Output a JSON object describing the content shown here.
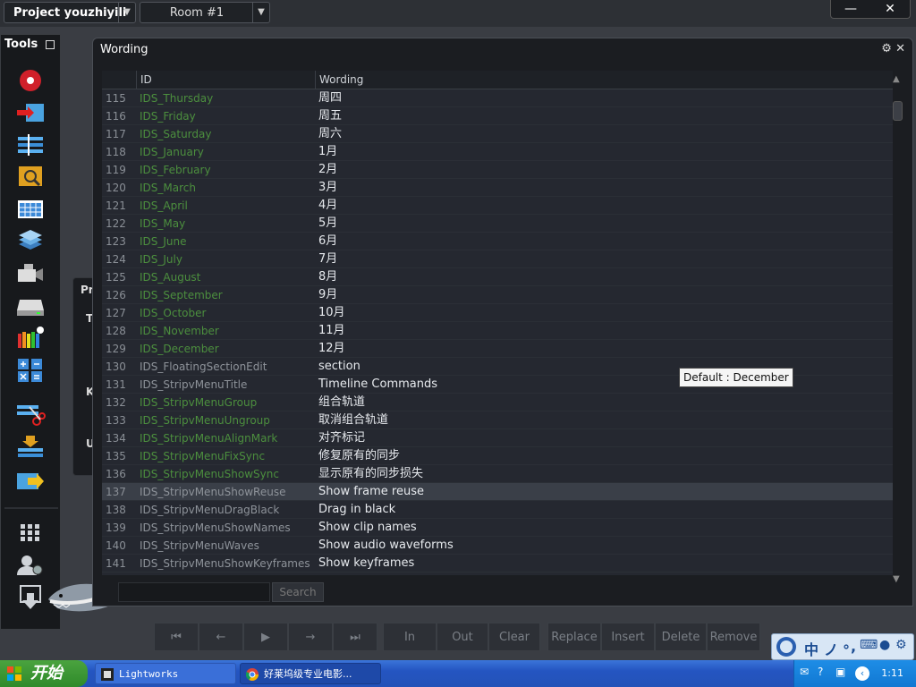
{
  "app": {
    "project": "Project youzhiyili",
    "room": "Room #1"
  },
  "tools": {
    "title": "Tools"
  },
  "bg_panel": {
    "letters": [
      "Pr",
      "T",
      "K",
      "U"
    ]
  },
  "wording": {
    "title": "Wording",
    "columns": {
      "id": "ID",
      "wording": "Wording"
    },
    "rows": [
      {
        "n": "115",
        "id": "IDS_Thursday",
        "w": "周四",
        "g": true
      },
      {
        "n": "116",
        "id": "IDS_Friday",
        "w": "周五",
        "g": true
      },
      {
        "n": "117",
        "id": "IDS_Saturday",
        "w": "周六",
        "g": true
      },
      {
        "n": "118",
        "id": "IDS_January",
        "w": "1月",
        "g": true
      },
      {
        "n": "119",
        "id": "IDS_February",
        "w": "2月",
        "g": true
      },
      {
        "n": "120",
        "id": "IDS_March",
        "w": "3月",
        "g": true
      },
      {
        "n": "121",
        "id": "IDS_April",
        "w": "4月",
        "g": true
      },
      {
        "n": "122",
        "id": "IDS_May",
        "w": "5月",
        "g": true
      },
      {
        "n": "123",
        "id": "IDS_June",
        "w": "6月",
        "g": true
      },
      {
        "n": "124",
        "id": "IDS_July",
        "w": "7月",
        "g": true
      },
      {
        "n": "125",
        "id": "IDS_August",
        "w": "8月",
        "g": true
      },
      {
        "n": "126",
        "id": "IDS_September",
        "w": "9月",
        "g": true
      },
      {
        "n": "127",
        "id": "IDS_October",
        "w": "10月",
        "g": true
      },
      {
        "n": "128",
        "id": "IDS_November",
        "w": "11月",
        "g": true
      },
      {
        "n": "129",
        "id": "IDS_December",
        "w": "12月",
        "g": true
      },
      {
        "n": "130",
        "id": "IDS_FloatingSectionEdit",
        "w": "section",
        "g": false
      },
      {
        "n": "131",
        "id": "IDS_StripvMenuTitle",
        "w": "Timeline Commands",
        "g": false
      },
      {
        "n": "132",
        "id": "IDS_StripvMenuGroup",
        "w": "组合轨道",
        "g": true
      },
      {
        "n": "133",
        "id": "IDS_StripvMenuUngroup",
        "w": "取消组合轨道",
        "g": true
      },
      {
        "n": "134",
        "id": "IDS_StripvMenuAlignMark",
        "w": "对齐标记",
        "g": true
      },
      {
        "n": "135",
        "id": "IDS_StripvMenuFixSync",
        "w": "修复原有的同步",
        "g": true
      },
      {
        "n": "136",
        "id": "IDS_StripvMenuShowSync",
        "w": "显示原有的同步损失",
        "g": true
      },
      {
        "n": "137",
        "id": "IDS_StripvMenuShowReuse",
        "w": "Show frame reuse",
        "g": false
      },
      {
        "n": "138",
        "id": "IDS_StripvMenuDragBlack",
        "w": "Drag in black",
        "g": false
      },
      {
        "n": "139",
        "id": "IDS_StripvMenuShowNames",
        "w": "Show clip names",
        "g": false
      },
      {
        "n": "140",
        "id": "IDS_StripvMenuWaves",
        "w": "Show audio waveforms",
        "g": false
      },
      {
        "n": "141",
        "id": "IDS_StripvMenuShowKeyframes",
        "w": "Show keyframes",
        "g": false
      }
    ],
    "selected_row": "137",
    "tooltip": "Default : December",
    "search_label": "Search",
    "search_value": ""
  },
  "transport": {
    "icons": [
      "skip-to-start-icon",
      "step-back-icon",
      "play-icon",
      "step-forward-icon",
      "skip-to-end-icon"
    ],
    "buttons": [
      "In",
      "Out",
      "Clear",
      "Replace",
      "Insert",
      "Delete",
      "Remove"
    ]
  },
  "ime": {
    "chars": [
      "中",
      "ノ",
      "∘,"
    ]
  },
  "taskbar": {
    "start": "开始",
    "tasks": [
      "Lightworks",
      "好莱坞级专业电影..."
    ],
    "clock": "1:11"
  },
  "colors": {
    "accent_green": "#4c8f3e",
    "record_red": "#d0202a",
    "taskbar_blue": "#2455c1",
    "start_green": "#3a9a35"
  }
}
